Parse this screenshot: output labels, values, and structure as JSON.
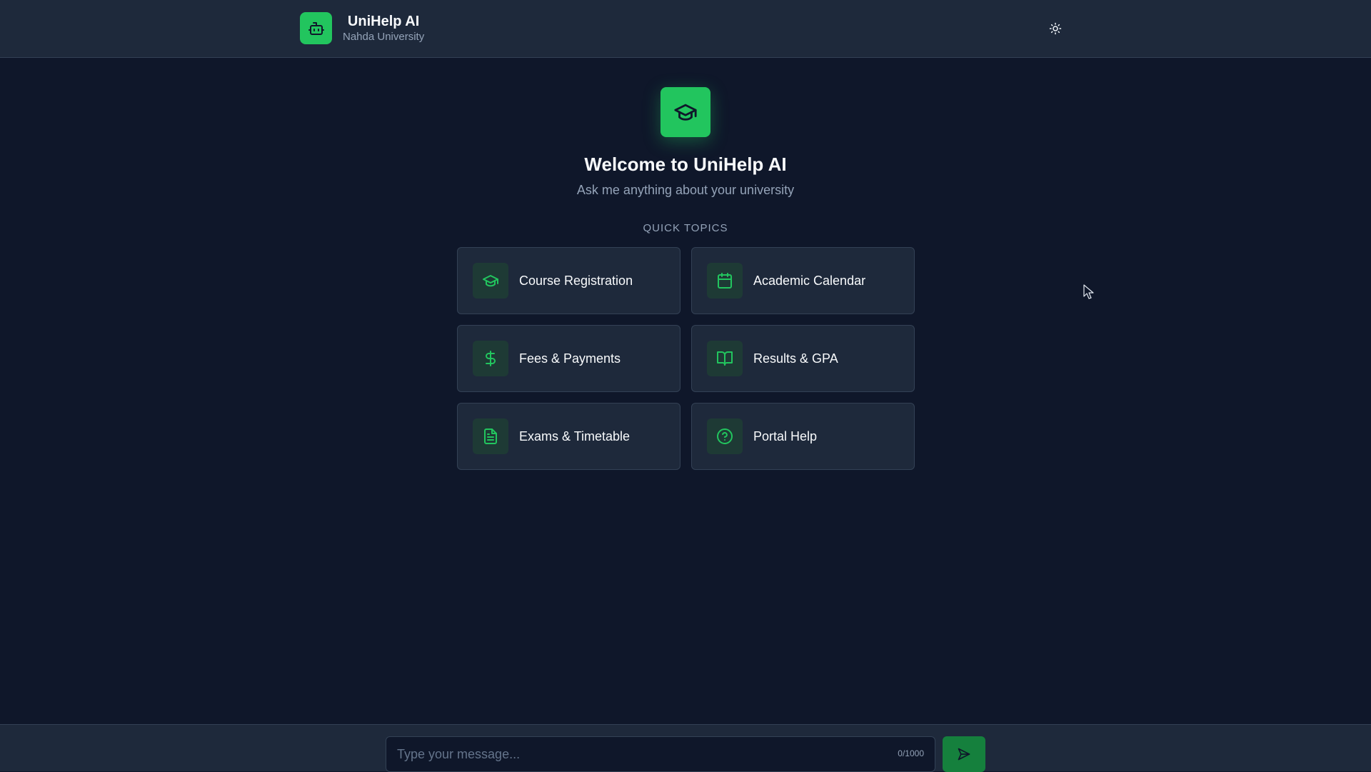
{
  "header": {
    "title": "UniHelp AI",
    "subtitle": "Nahda University",
    "logo_icon": "robot-icon",
    "theme_icon": "sun-icon"
  },
  "hero": {
    "icon": "graduation-cap-icon",
    "title": "Welcome to UniHelp AI",
    "subtitle": "Ask me anything about your university"
  },
  "topics": {
    "label": "QUICK TOPICS",
    "items": [
      {
        "label": "Course Registration",
        "icon": "graduation-cap-icon"
      },
      {
        "label": "Academic Calendar",
        "icon": "calendar-icon"
      },
      {
        "label": "Fees & Payments",
        "icon": "dollar-icon"
      },
      {
        "label": "Results & GPA",
        "icon": "book-open-icon"
      },
      {
        "label": "Exams & Timetable",
        "icon": "document-icon"
      },
      {
        "label": "Portal Help",
        "icon": "help-circle-icon"
      }
    ]
  },
  "composer": {
    "placeholder": "Type your message...",
    "value": "",
    "counter": "0/1000",
    "send_icon": "send-icon"
  },
  "colors": {
    "background": "#0f172a",
    "surface": "#1e293b",
    "accent": "#22c55e",
    "border": "#334155",
    "muted": "#94a3b8"
  }
}
